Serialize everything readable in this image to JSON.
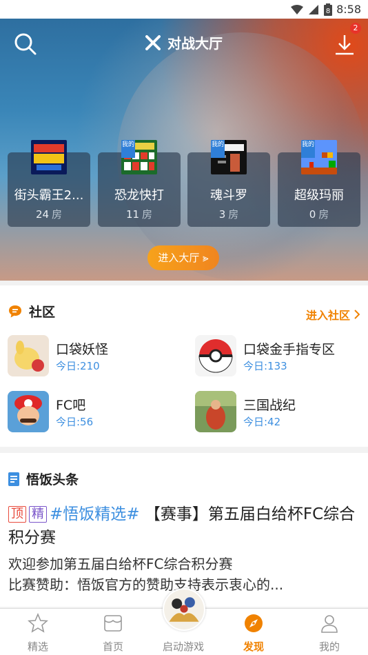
{
  "status_bar": {
    "time": "8:58",
    "battery": "8"
  },
  "hero": {
    "title": "对战大厅",
    "download_badge": "2",
    "enter_button": "进入大厅 ⪢",
    "games": [
      {
        "name": "街头霸王2...",
        "rooms": "24",
        "mine": false
      },
      {
        "name": "恐龙快打",
        "rooms": "11",
        "mine": true
      },
      {
        "name": "魂斗罗",
        "rooms": "3",
        "mine": true
      },
      {
        "name": "超级玛丽",
        "rooms": "0",
        "mine": true
      }
    ],
    "rooms_unit": "房",
    "mine_label": "我的"
  },
  "community": {
    "title": "社区",
    "more": "进入社区",
    "forums": [
      {
        "name": "口袋妖怪",
        "today": "今日:210"
      },
      {
        "name": "口袋金手指专区",
        "today": "今日:133"
      },
      {
        "name": "FC吧",
        "today": "今日:56"
      },
      {
        "name": "三国战纪",
        "today": "今日:42"
      }
    ]
  },
  "news": {
    "title": "悟饭头条",
    "tag_top": "顶",
    "tag_best": "精",
    "topic": "#悟饭精选#",
    "headline": " 【赛事】第五届白给杯FC综合积分赛",
    "desc_line1": "欢迎参加第五届白给杯FC综合积分赛",
    "desc_line2": "比赛赞助：悟饭官方的赞助支持表示衷心的..."
  },
  "tabbar": {
    "tabs": [
      {
        "label": "精选"
      },
      {
        "label": "首页"
      },
      {
        "label": "启动游戏"
      },
      {
        "label": "发现"
      },
      {
        "label": "我的"
      }
    ],
    "active_color": "#f08200"
  }
}
